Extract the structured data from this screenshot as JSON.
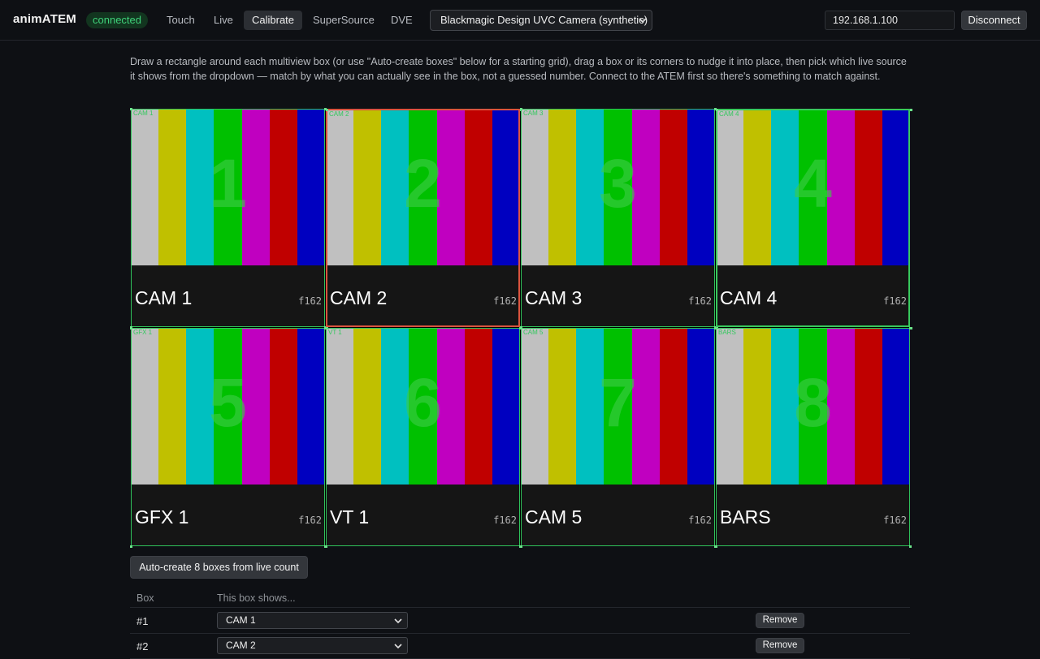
{
  "app": {
    "name": "animATEM",
    "status": "connected"
  },
  "nav": {
    "tabs": [
      {
        "label": "Touch",
        "active": false
      },
      {
        "label": "Live",
        "active": false
      },
      {
        "label": "Calibrate",
        "active": true
      },
      {
        "label": "SuperSource",
        "active": false
      },
      {
        "label": "DVE",
        "active": false
      }
    ]
  },
  "camera_select": {
    "value": "Blackmagic Design UVC Camera (synthetic)"
  },
  "connection": {
    "ip": "192.168.1.100",
    "disconnect_label": "Disconnect"
  },
  "instructions": "Draw a rectangle around each multiview box (or use \"Auto-create boxes\" below for a starting grid), drag a box or its corners to nudge it into place, then pick which live source it shows from the dropdown — match by what you can actually see in the box, not a guessed number. Connect to the ATEM first so there's something to match against.",
  "multiview": {
    "bar_colors": [
      "#c0c0c0",
      "#c0c000",
      "#00c0c0",
      "#00c000",
      "#c000c0",
      "#c00000",
      "#0000c0"
    ],
    "tiles": [
      {
        "number": "1",
        "label": "CAM 1",
        "format": "f162",
        "box_tag": "CAM 1",
        "state": "normal"
      },
      {
        "number": "2",
        "label": "CAM 2",
        "format": "f162",
        "box_tag": "CAM 2",
        "state": "selected-red"
      },
      {
        "number": "3",
        "label": "CAM 3",
        "format": "f162",
        "box_tag": "CAM 3",
        "state": "normal"
      },
      {
        "number": "4",
        "label": "CAM 4",
        "format": "f162",
        "box_tag": "CAM 4",
        "state": "selected-green"
      },
      {
        "number": "5",
        "label": "GFX 1",
        "format": "f162",
        "box_tag": "GFX 1",
        "state": "normal"
      },
      {
        "number": "6",
        "label": "VT 1",
        "format": "f162",
        "box_tag": "VT 1",
        "state": "normal"
      },
      {
        "number": "7",
        "label": "CAM 5",
        "format": "f162",
        "box_tag": "CAM 5",
        "state": "normal"
      },
      {
        "number": "8",
        "label": "BARS",
        "format": "f162",
        "box_tag": "BARS",
        "state": "normal"
      }
    ]
  },
  "auto_create_label": "Auto-create 8 boxes from live count",
  "boxes_table": {
    "headers": {
      "box": "Box",
      "shows": "This box shows..."
    },
    "rows": [
      {
        "box": "#1",
        "source": "CAM 1",
        "remove_label": "Remove"
      },
      {
        "box": "#2",
        "source": "CAM 2",
        "remove_label": "Remove"
      }
    ]
  },
  "colors": {
    "accent_green": "#38c95c",
    "selected_red": "#d9533e",
    "background": "#0e1014"
  }
}
